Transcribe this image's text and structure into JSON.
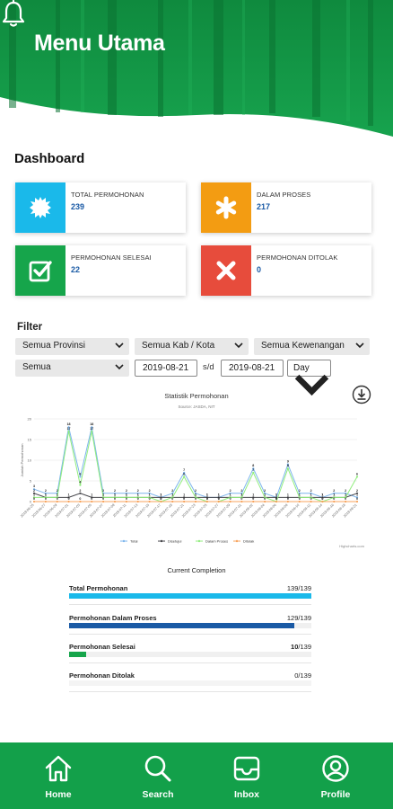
{
  "header": {
    "title": "Menu Utama",
    "bell_icon": "bell-icon"
  },
  "dashboard": {
    "title": "Dashboard",
    "cards": [
      {
        "label": "TOTAL PERMOHONAN",
        "value": "239",
        "color": "#1ab9ea",
        "icon": "gear-burst-icon"
      },
      {
        "label": "DALAM PROSES",
        "value": "217",
        "color": "#f39c12",
        "icon": "asterisk-icon"
      },
      {
        "label": "PERMOHONAN SELESAI",
        "value": "22",
        "color": "#16a54b",
        "icon": "check-box-icon"
      },
      {
        "label": "PERMOHONAN DITOLAK",
        "value": "0",
        "color": "#e74c3c",
        "icon": "cross-icon"
      }
    ]
  },
  "filter": {
    "label": "Filter",
    "provinsi": "Semua Provinsi",
    "kab_kota": "Semua Kab / Kota",
    "kewenangan": "Semua Kewenangan",
    "semua": "Semua",
    "date_from": "2019-08-21",
    "date_sep": "s/d",
    "date_to": "2019-08-21",
    "period": "Day"
  },
  "chart_data": {
    "type": "line",
    "title": "Statistik Permohonan",
    "subtitle": "Source: JASDA, NIT",
    "ylabel": "Jumlah Permohonan",
    "ylim": [
      0,
      20
    ],
    "yticks": [
      0,
      5,
      10,
      15,
      20
    ],
    "credit": "Highcharts.com",
    "x": [
      "2019-06-25",
      "2019-06-27",
      "2019-06-29",
      "2019-07-01",
      "2019-07-03",
      "2019-07-05",
      "2019-07-07",
      "2019-07-09",
      "2019-07-11",
      "2019-07-13",
      "2019-07-15",
      "2019-07-17",
      "2019-07-19",
      "2019-07-21",
      "2019-07-23",
      "2019-07-25",
      "2019-07-27",
      "2019-07-29",
      "2019-07-31",
      "2019-08-02",
      "2019-08-04",
      "2019-08-06",
      "2019-08-08",
      "2019-08-10",
      "2019-08-12",
      "2019-08-14",
      "2019-08-16",
      "2019-08-18",
      "2019-08-21"
    ],
    "series": [
      {
        "name": "Total",
        "color": "#7cb5ec",
        "values": [
          3,
          2,
          2,
          18,
          6,
          18,
          2,
          2,
          2,
          2,
          2,
          1,
          2,
          7,
          2,
          1,
          1,
          2,
          2,
          8,
          2,
          1,
          9,
          2,
          2,
          1,
          2,
          2,
          1
        ]
      },
      {
        "name": "Disetujui",
        "color": "#434348",
        "values": [
          2,
          1,
          1,
          1,
          2,
          1,
          1,
          1,
          1,
          1,
          1,
          1,
          1,
          1,
          1,
          1,
          1,
          1,
          1,
          1,
          1,
          1,
          1,
          1,
          1,
          1,
          1,
          1,
          2
        ]
      },
      {
        "name": "Dalam Proses",
        "color": "#90ed7d",
        "values": [
          1,
          1,
          1,
          17,
          4,
          17,
          1,
          1,
          1,
          1,
          1,
          0,
          1,
          6,
          1,
          0,
          0,
          1,
          1,
          7,
          1,
          0,
          8,
          1,
          1,
          0,
          1,
          1,
          6
        ]
      },
      {
        "name": "Ditolak",
        "color": "#f7a35c",
        "values": [
          0,
          0,
          0,
          0,
          0,
          0,
          0,
          0,
          0,
          0,
          0,
          0,
          0,
          0,
          0,
          0,
          0,
          0,
          0,
          0,
          0,
          0,
          0,
          0,
          0,
          0,
          0,
          0,
          0
        ]
      }
    ]
  },
  "completion": {
    "title": "Current Completion",
    "rows": [
      {
        "name": "Total Permohonan",
        "num": "139",
        "den": "/139",
        "fraction": 1.0,
        "color": "#1ab9ea"
      },
      {
        "name": "Permohonan Dalam Proses",
        "num": "129",
        "den": "/139",
        "fraction": 0.928,
        "color": "#1a5aa5"
      },
      {
        "name": "Permohonan Selesai",
        "num": "10",
        "den": "/139",
        "fraction": 0.072,
        "color": "#16a54b"
      },
      {
        "name": "Permohonan Ditolak",
        "num": "0",
        "den": "/139",
        "fraction": 0.0,
        "color": "#e74c3c"
      }
    ]
  },
  "nav": [
    {
      "label": "Home",
      "icon": "home-icon"
    },
    {
      "label": "Search",
      "icon": "search-icon"
    },
    {
      "label": "Inbox",
      "icon": "inbox-icon"
    },
    {
      "label": "Profile",
      "icon": "profile-icon"
    }
  ],
  "colors": {
    "brand_green": "#13a04a"
  }
}
